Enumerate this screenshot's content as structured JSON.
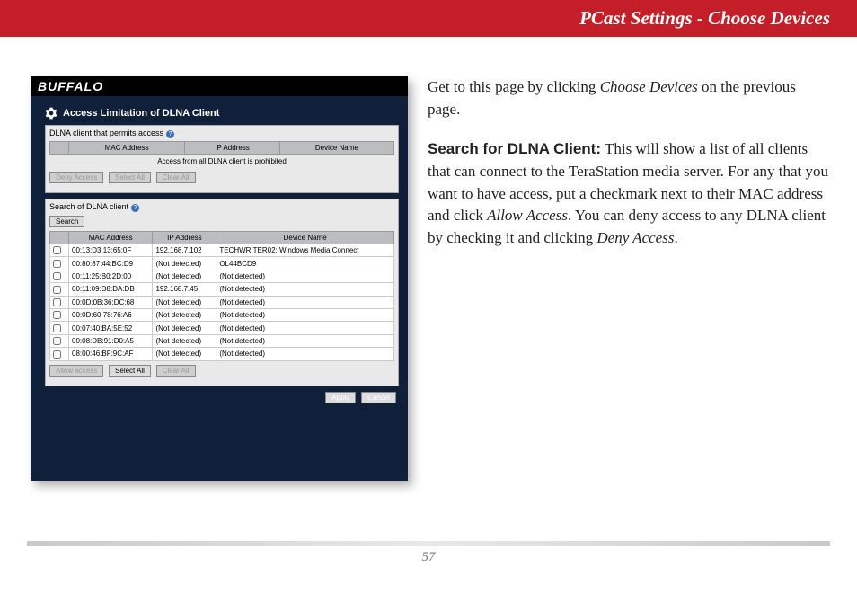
{
  "header": {
    "title": "PCast Settings - Choose Devices"
  },
  "screenshot": {
    "brand": "BUFFALO",
    "section_title": "Access Limitation of DLNA Client",
    "panel1": {
      "label": "DLNA client that permits access",
      "cols": [
        "MAC Address",
        "IP Address",
        "Device Name"
      ],
      "empty_msg": "Access from all DLNA client is prohibited",
      "btn_deny": "Deny Access",
      "btn_select_all": "Select All",
      "btn_clear_all": "Clear All"
    },
    "panel2": {
      "label": "Search of DLNA client",
      "btn_search": "Search",
      "cols": [
        "MAC Address",
        "IP Address",
        "Device Name"
      ],
      "rows": [
        {
          "mac": "00:13:D3:13:65:0F",
          "ip": "192.168.7.102",
          "dev": "TECHWRITER02: Windows Media Connect"
        },
        {
          "mac": "00:80:87:44:BC:D9",
          "ip": "(Not detected)",
          "dev": "OL44BCD9"
        },
        {
          "mac": "00:11:25:B0:2D:00",
          "ip": "(Not detected)",
          "dev": "(Not detected)"
        },
        {
          "mac": "00:11:09:D8:DA:DB",
          "ip": "192.168.7.45",
          "dev": "(Not detected)"
        },
        {
          "mac": "00:0D:0B:36:DC:68",
          "ip": "(Not detected)",
          "dev": "(Not detected)"
        },
        {
          "mac": "00:0D:60:78:76:A6",
          "ip": "(Not detected)",
          "dev": "(Not detected)"
        },
        {
          "mac": "00:07:40:BA:5E:52",
          "ip": "(Not detected)",
          "dev": "(Not detected)"
        },
        {
          "mac": "00:08:DB:91:D0:A5",
          "ip": "(Not detected)",
          "dev": "(Not detected)"
        },
        {
          "mac": "08:00:46:BF:9C:AF",
          "ip": "(Not detected)",
          "dev": "(Not detected)"
        }
      ],
      "btn_allow": "Allow access",
      "btn_select_all": "Select All",
      "btn_clear_all": "Clear All"
    },
    "btn_apply": "Apply",
    "btn_cancel": "Cancel"
  },
  "body": {
    "p1_a": "Get to this page by clicking ",
    "p1_i": "Choose Devices",
    "p1_b": " on the previous page.",
    "p2_lead": "Search for DLNA Client:",
    "p2_a": "  This will show a list of all clients that can connect to the TeraStation media server.  For any that you want to have access, put a checkmark next to their MAC address and click ",
    "p2_i1": "Allow Access",
    "p2_b": ".  You can deny access to any DLNA client by checking it and clicking ",
    "p2_i2": "Deny Access",
    "p2_c": "."
  },
  "page_number": "57"
}
